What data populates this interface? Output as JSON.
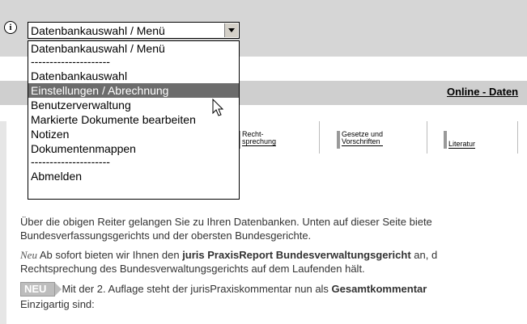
{
  "select": {
    "value": "Datenbankauswahl / Menü"
  },
  "dropdown": {
    "options": [
      "Datenbankauswahl / Menü",
      "---------------------",
      "Datenbankauswahl",
      "Einstellungen / Abrechnung",
      "Benutzerverwaltung",
      "Markierte Dokumente bearbeiten",
      "Notizen",
      "Dokumentenmappen",
      "---------------------",
      "Abmelden"
    ],
    "highlighted": "Einstellungen / Abrechnung"
  },
  "header": {
    "link": "Online - Daten"
  },
  "tabs": [
    {
      "label": "Recht-\nsprechung"
    },
    {
      "label": "Gesetze und\nVorschriften"
    },
    {
      "label": "Literatur"
    }
  ],
  "content": {
    "p1_line1": "Über die obigen Reiter gelangen Sie zu Ihren Datenbanken. Unten auf dieser Seite biete",
    "p1_line2": "Bundesverfassungsgerichts und der obersten Bundesgerichte.",
    "p2_neu": "Neu",
    "p2_pre": " Ab sofort bieten wir Ihnen den ",
    "p2_bold": "juris PraxisReport Bundesverwaltungsgericht",
    "p2_post": " an, d",
    "p2_line2": "Rechtsprechung des Bundesverwaltungsgerichts auf dem Laufenden hält.",
    "p3_badge": "NEU",
    "p3_pre": "Mit der 2. Auflage steht der jurisPraxiskommentar nun als ",
    "p3_bold": "Gesamtkommentar",
    "p3_line2": "Einzigartig sind:"
  },
  "colors": {
    "topbar": "#d6d6d6",
    "highlight": "#6c6c6c"
  }
}
